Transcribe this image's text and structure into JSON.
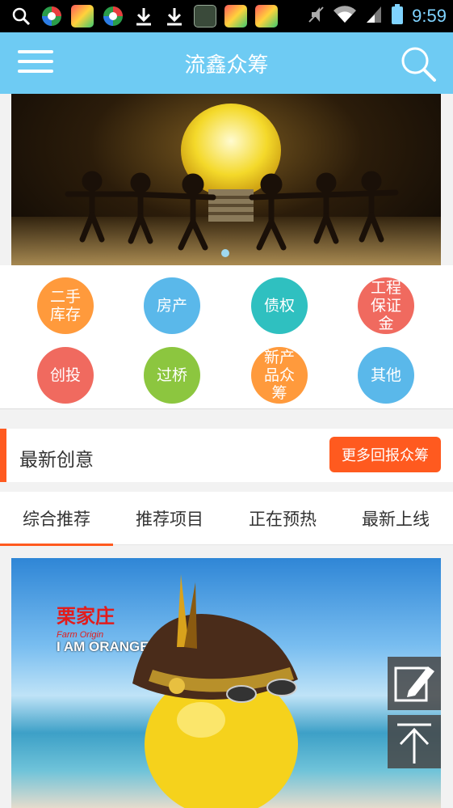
{
  "status_bar": {
    "time": "9:59"
  },
  "app_bar": {
    "title": "流鑫众筹"
  },
  "categories": [
    {
      "label": "二手库存",
      "color": "#ff9a3c"
    },
    {
      "label": "房产",
      "color": "#5ab8ea"
    },
    {
      "label": "债权",
      "color": "#2fc0c0"
    },
    {
      "label": "工程保证金",
      "color": "#f06a5f"
    },
    {
      "label": "创投",
      "color": "#f06a5f"
    },
    {
      "label": "过桥",
      "color": "#8cc63f"
    },
    {
      "label": "新产品众筹",
      "color": "#ff9a3c"
    },
    {
      "label": "其他",
      "color": "#5ab8ea"
    }
  ],
  "section": {
    "title": "最新创意",
    "more_button": "更多回报众筹"
  },
  "tabs": [
    {
      "label": "综合推荐",
      "active": true
    },
    {
      "label": "推荐项目",
      "active": false
    },
    {
      "label": "正在预热",
      "active": false
    },
    {
      "label": "最新上线",
      "active": false
    }
  ],
  "product": {
    "brand_cn": "栗家庄",
    "brand_en": "Farm Origin",
    "tagline": "I AM ORANGE"
  },
  "colors": {
    "primary": "#6ecbf3",
    "accent": "#ff5a1f"
  }
}
